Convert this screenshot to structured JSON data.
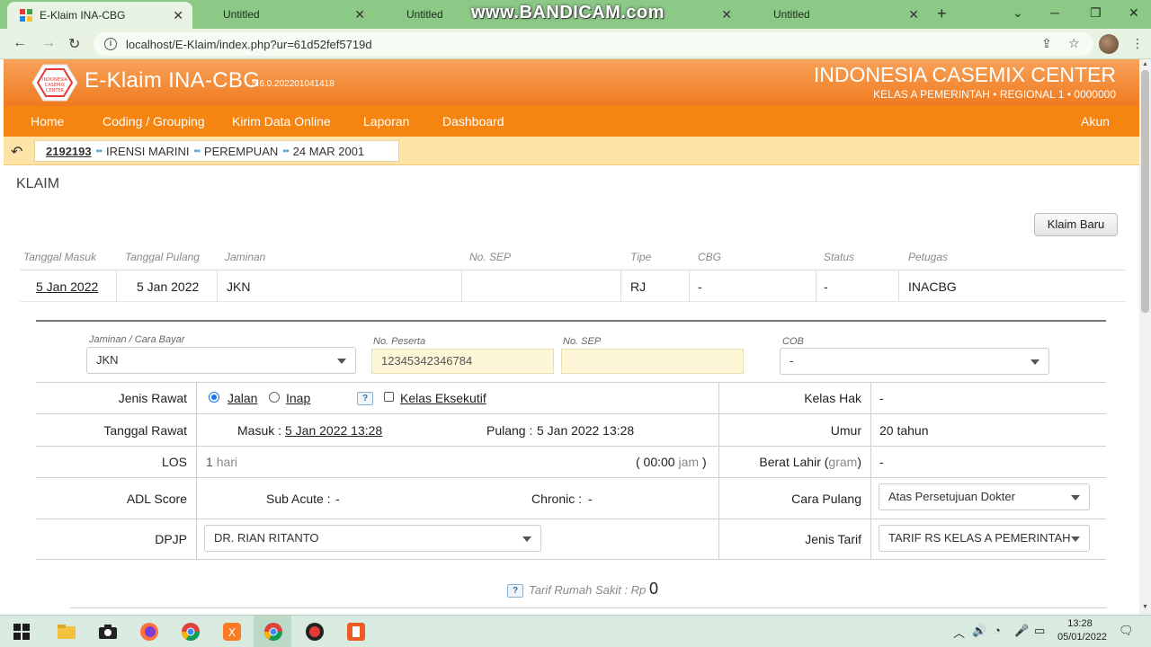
{
  "browser": {
    "tabs": [
      {
        "label": "E-Klaim INA-CBG",
        "active": true
      },
      {
        "label": "Untitled",
        "active": false
      },
      {
        "label": "Untitled",
        "active": false
      },
      {
        "label": "Untitled",
        "active": false
      }
    ],
    "watermark": "www.BANDICAM.com",
    "url": "localhost/E-Klaim/index.php?ur=61d52fef5719d"
  },
  "app": {
    "title": "E-Klaim INA-CBG",
    "version": "5.6.0.202201041418",
    "center_name": "INDONESIA CASEMIX CENTER",
    "center_sub": "KELAS A PEMERINTAH • REGIONAL 1 • 0000000",
    "logo_text": "INDONESIA CASEMIX CENTER"
  },
  "nav": {
    "home": "Home",
    "coding": "Coding / Grouping",
    "kirim": "Kirim Data Online",
    "laporan": "Laporan",
    "dashboard": "Dashboard",
    "akun": "Akun"
  },
  "patient": {
    "rm": "2192193",
    "name": "IRENSI MARINI",
    "gender": "PEREMPUAN",
    "dob": "24 MAR 2001",
    "sep": "••"
  },
  "page": {
    "title": "KLAIM",
    "new_claim_button": "Klaim Baru"
  },
  "claim_list": {
    "headers": {
      "tgl_masuk": "Tanggal Masuk",
      "tgl_pulang": "Tanggal Pulang",
      "jaminan": "Jaminan",
      "no_sep": "No. SEP",
      "tipe": "Tipe",
      "cbg": "CBG",
      "status": "Status",
      "petugas": "Petugas"
    },
    "row": {
      "tgl_masuk": "5 Jan 2022",
      "tgl_pulang": "5 Jan 2022",
      "jaminan": "JKN",
      "no_sep": "",
      "tipe": "RJ",
      "cbg": "-",
      "status": "-",
      "petugas": "INACBG"
    }
  },
  "form": {
    "jaminan_label": "Jaminan / Cara Bayar",
    "jaminan_value": "JKN",
    "peserta_label": "No. Peserta",
    "peserta_value": "12345342346784",
    "sep_label": "No. SEP",
    "sep_value": "",
    "cob_label": "COB",
    "cob_value": "-",
    "jenis_rawat_label": "Jenis Rawat",
    "jalan_label": "Jalan",
    "inap_label": "Inap",
    "help_label": "?",
    "eksekutif_label": "Kelas Eksekutif",
    "kelas_hak_label": "Kelas Hak",
    "kelas_hak_value": "-",
    "tanggal_rawat_label": "Tanggal Rawat",
    "masuk_label": "Masuk :",
    "masuk_value": "5 Jan 2022 13:28",
    "pulang_label": "Pulang :",
    "pulang_value": "5 Jan 2022 13:28",
    "umur_label": "Umur",
    "umur_value": "20 tahun",
    "los_label": "LOS",
    "los_value": "1",
    "los_unit": "hari",
    "jam_open": "( 00:00",
    "jam_unit": "jam",
    "jam_close": ")",
    "berat_label": "Berat Lahir (",
    "berat_unit": "gram",
    "berat_close": ")",
    "berat_value": "-",
    "adl_label": "ADL Score",
    "sub_acute_label": "Sub Acute :",
    "sub_acute_value": "-",
    "chronic_label": "Chronic :",
    "chronic_value": "-",
    "cara_pulang_label": "Cara Pulang",
    "cara_pulang_value": "Atas Persetujuan Dokter",
    "dpjp_label": "DPJP",
    "dpjp_value": "DR. RIAN RITANTO",
    "jenis_tarif_label": "Jenis Tarif",
    "jenis_tarif_value": "TARIF RS KELAS A PEMERINTAH",
    "tarif_label": "Tarif Rumah Sakit : Rp",
    "tarif_value": "0"
  },
  "taskbar": {
    "time": "13:28",
    "date": "05/01/2022"
  },
  "colors": {
    "header_orange": "#f07a1e",
    "nav_orange": "#f58410",
    "patient_bar": "#fde4a6",
    "browser_green": "#8cc886"
  }
}
